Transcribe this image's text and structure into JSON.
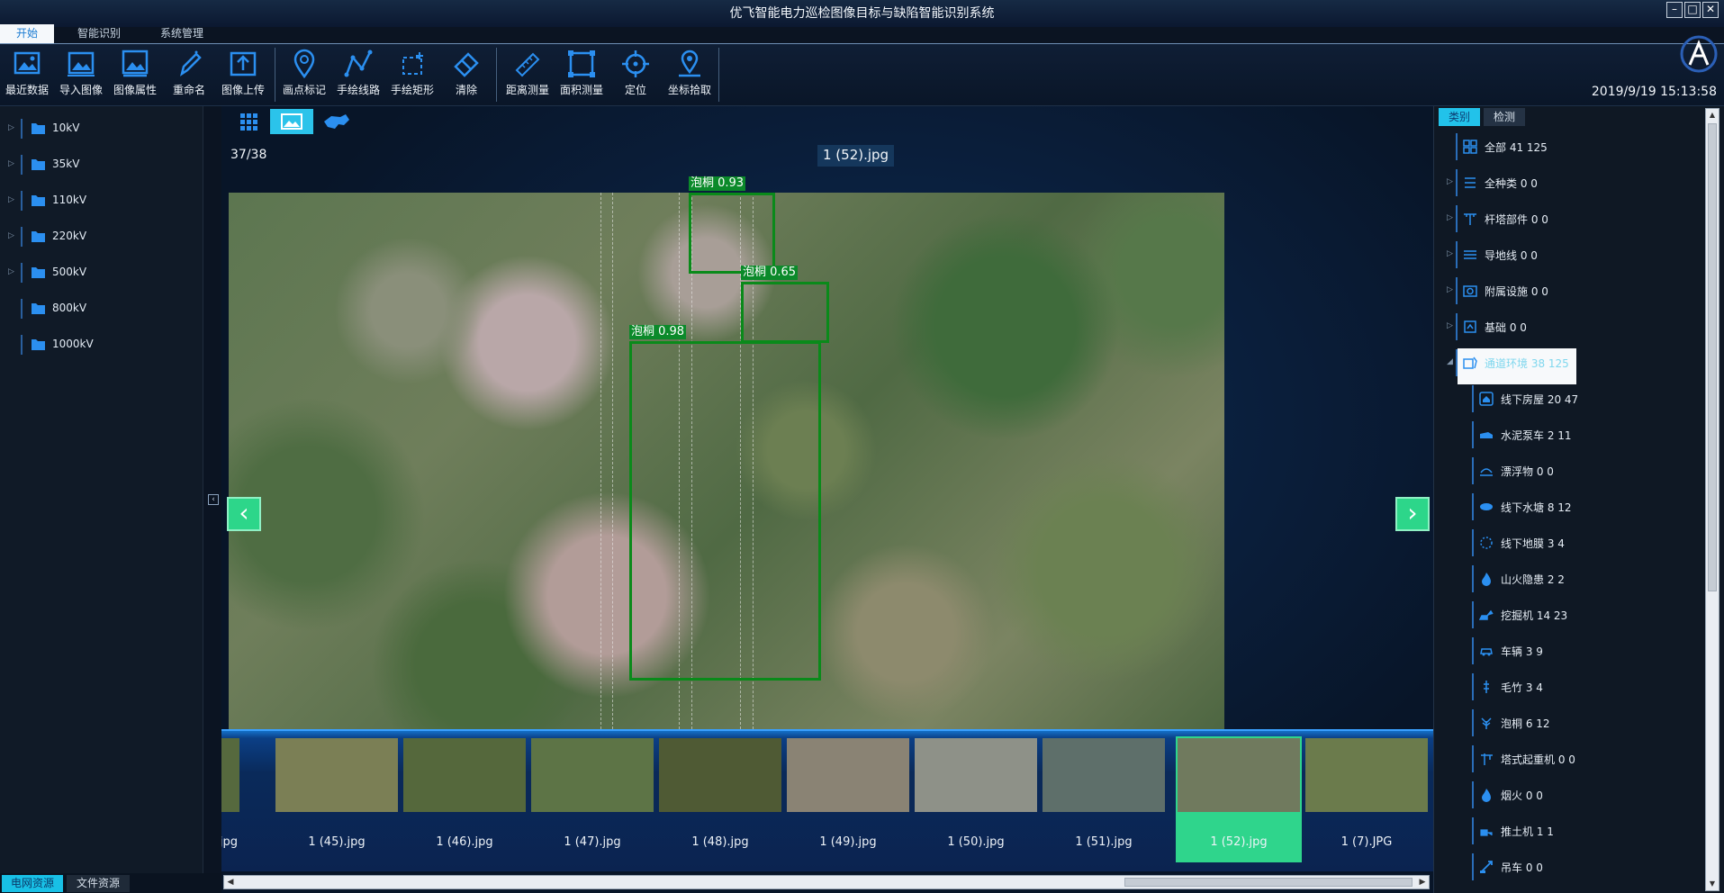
{
  "window": {
    "title": "优飞智能电力巡检图像目标与缺陷智能识别系统"
  },
  "menu": {
    "tabs": [
      {
        "label": "开始"
      },
      {
        "label": "智能识别"
      },
      {
        "label": "系统管理"
      }
    ]
  },
  "toolbar": {
    "items": [
      {
        "label": "最近数据",
        "icon": "image-icon"
      },
      {
        "label": "导入图像",
        "icon": "import-image-icon"
      },
      {
        "label": "图像属性",
        "icon": "image-properties-icon"
      },
      {
        "label": "重命名",
        "icon": "rename-pen-icon"
      },
      {
        "label": "图像上传",
        "icon": "upload-icon"
      },
      {
        "label": "画点标记",
        "icon": "map-pin-icon"
      },
      {
        "label": "手绘线路",
        "icon": "polyline-icon"
      },
      {
        "label": "手绘矩形",
        "icon": "rectangle-icon"
      },
      {
        "label": "清除",
        "icon": "eraser-icon"
      },
      {
        "label": "距离测量",
        "icon": "ruler-icon"
      },
      {
        "label": "面积测量",
        "icon": "area-icon"
      },
      {
        "label": "定位",
        "icon": "crosshair-icon"
      },
      {
        "label": "坐标拾取",
        "icon": "coordinate-pin-icon"
      }
    ],
    "datetime": "2019/9/19 15:13:58"
  },
  "left_tree": {
    "items": [
      {
        "label": "10kV",
        "expandable": true
      },
      {
        "label": "35kV",
        "expandable": true
      },
      {
        "label": "110kV",
        "expandable": true
      },
      {
        "label": "220kV",
        "expandable": true
      },
      {
        "label": "500kV",
        "expandable": true
      },
      {
        "label": "800kV",
        "expandable": false
      },
      {
        "label": "1000kV",
        "expandable": false
      }
    ],
    "bottom_tabs": [
      {
        "label": "电网资源",
        "active": true
      },
      {
        "label": "文件资源",
        "active": false
      }
    ]
  },
  "viewer": {
    "counter": "37/38",
    "filename": "1 (52).jpg",
    "detections": [
      {
        "label": "泡桐 0.93"
      },
      {
        "label": "泡桐 0.65"
      },
      {
        "label": "泡桐 0.98"
      }
    ],
    "prev": "‹",
    "next": "›"
  },
  "filmstrip": {
    "partial_label": "jpg",
    "thumbs": [
      {
        "name": "1 (45).jpg",
        "color": "#7b7f55"
      },
      {
        "name": "1 (46).jpg",
        "color": "#55683c"
      },
      {
        "name": "1 (47).jpg",
        "color": "#5d7446"
      },
      {
        "name": "1 (48).jpg",
        "color": "#4f5a34"
      },
      {
        "name": "1 (49).jpg",
        "color": "#8a8374"
      },
      {
        "name": "1 (50).jpg",
        "color": "#8e9188"
      },
      {
        "name": "1 (51).jpg",
        "color": "#5e6f6a"
      },
      {
        "name": "1 (52).jpg",
        "color": "#707a5e",
        "selected": true
      },
      {
        "name": "1 (7).JPG",
        "color": "#6b7b4c"
      }
    ]
  },
  "right_panel": {
    "tabs": [
      {
        "label": "类别",
        "active": true
      },
      {
        "label": "检测",
        "active": false
      }
    ],
    "items": [
      {
        "label": "全部 41 125",
        "icon": "grid-icon",
        "level": 0,
        "expandable": false
      },
      {
        "label": "全种类 0 0",
        "icon": "list-icon",
        "level": 0,
        "expandable": true
      },
      {
        "label": "杆塔部件 0 0",
        "icon": "tower-icon",
        "level": 0,
        "expandable": true
      },
      {
        "label": "导地线 0 0",
        "icon": "lines-icon",
        "level": 0,
        "expandable": true
      },
      {
        "label": "附属设施 0 0",
        "icon": "camera-icon",
        "level": 0,
        "expandable": true
      },
      {
        "label": "基础 0 0",
        "icon": "foundation-icon",
        "level": 0,
        "expandable": true
      },
      {
        "label": "通道环境 38 125",
        "icon": "environment-icon",
        "level": 0,
        "expandable": true,
        "expanded": true,
        "highlight": true
      },
      {
        "label": "线下房屋 20 47",
        "icon": "house-icon",
        "level": 1
      },
      {
        "label": "水泥泵车 2 11",
        "icon": "pump-truck-icon",
        "level": 1
      },
      {
        "label": "漂浮物 0 0",
        "icon": "floating-object-icon",
        "level": 1
      },
      {
        "label": "线下水塘 8 12",
        "icon": "pond-icon",
        "level": 1
      },
      {
        "label": "线下地膜 3 4",
        "icon": "film-icon",
        "level": 1
      },
      {
        "label": "山火隐患 2 2",
        "icon": "fire-icon",
        "level": 1
      },
      {
        "label": "挖掘机 14 23",
        "icon": "excavator-icon",
        "level": 1
      },
      {
        "label": "车辆 3 9",
        "icon": "car-icon",
        "level": 1
      },
      {
        "label": "毛竹 3 4",
        "icon": "bamboo-icon",
        "level": 1
      },
      {
        "label": "泡桐 6 12",
        "icon": "tree-icon",
        "level": 1
      },
      {
        "label": "塔式起重机 0 0",
        "icon": "tower-crane-icon",
        "level": 1
      },
      {
        "label": "烟火 0 0",
        "icon": "smoke-fire-icon",
        "level": 1
      },
      {
        "label": "推土机 1 1",
        "icon": "bulldozer-icon",
        "level": 1
      },
      {
        "label": "吊车 0 0",
        "icon": "crane-icon",
        "level": 1
      }
    ]
  },
  "colors": {
    "accent": "#22c2ea",
    "selection": "#2fd58c",
    "bbox": "#0a8a1a",
    "icon": "#2b8ff0"
  }
}
